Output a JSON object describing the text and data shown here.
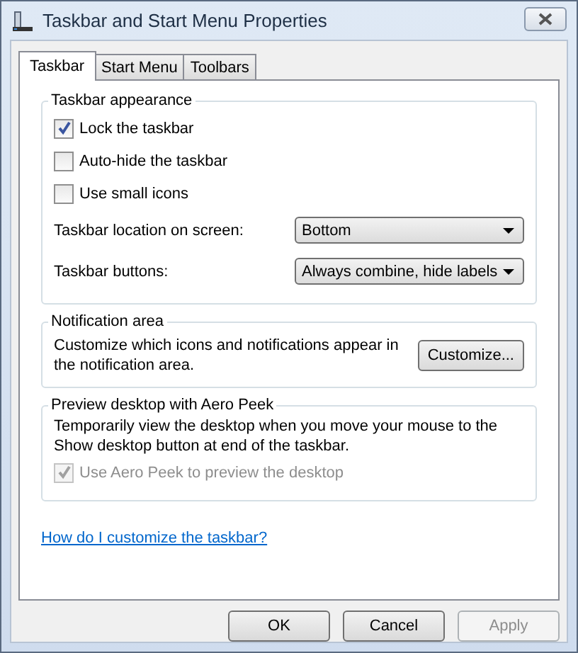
{
  "window": {
    "title": "Taskbar and Start Menu Properties"
  },
  "tabs": [
    {
      "label": "Taskbar",
      "selected": true
    },
    {
      "label": "Start Menu",
      "selected": false
    },
    {
      "label": "Toolbars",
      "selected": false
    }
  ],
  "appearance": {
    "title": "Taskbar appearance",
    "checkboxes": [
      {
        "label": "Lock the taskbar",
        "checked": true,
        "disabled": false
      },
      {
        "label": "Auto-hide the taskbar",
        "checked": false,
        "disabled": false
      },
      {
        "label": "Use small icons",
        "checked": false,
        "disabled": false
      }
    ],
    "selects": [
      {
        "label": "Taskbar location on screen:",
        "value": "Bottom"
      },
      {
        "label": "Taskbar buttons:",
        "value": "Always combine, hide labels"
      }
    ]
  },
  "notification": {
    "title": "Notification area",
    "text": "Customize which icons and notifications appear in the notification area.",
    "button": "Customize..."
  },
  "peek": {
    "title": "Preview desktop with Aero Peek",
    "text": "Temporarily view the desktop when you move your mouse to the Show desktop button at end of the taskbar.",
    "checkbox": {
      "label": "Use Aero Peek to preview the desktop",
      "checked": true,
      "disabled": true
    }
  },
  "help_link": "How do I customize the taskbar?",
  "buttons": [
    {
      "label": "OK",
      "disabled": false
    },
    {
      "label": "Cancel",
      "disabled": false
    },
    {
      "label": "Apply",
      "disabled": true
    }
  ]
}
